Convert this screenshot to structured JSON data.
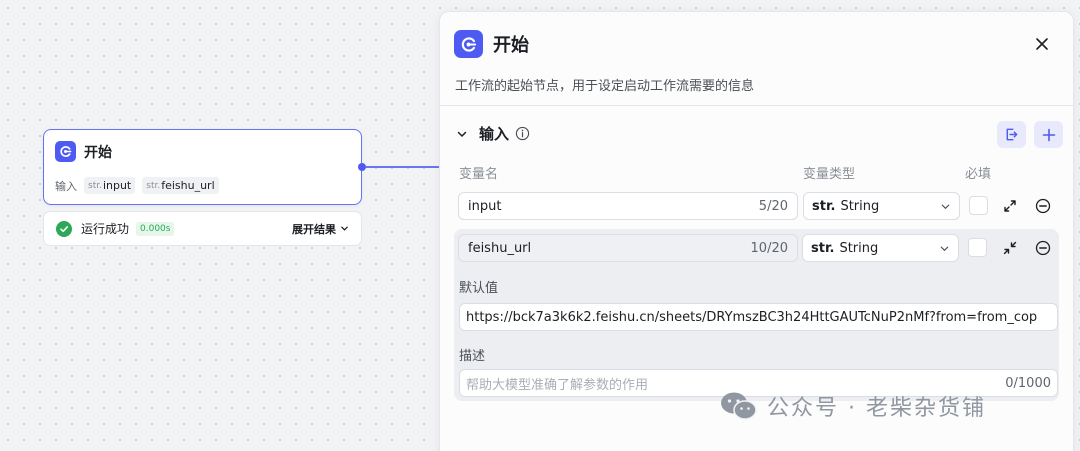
{
  "node": {
    "title": "开始",
    "inputs_label": "输入",
    "inputs": [
      {
        "prefix": "str.",
        "name": "input"
      },
      {
        "prefix": "str.",
        "name": "feishu_url"
      }
    ]
  },
  "run_status": {
    "label": "运行成功",
    "time": "0.000s",
    "expand_label": "展开结果"
  },
  "panel": {
    "title": "开始",
    "description": "工作流的起始节点，用于设定启动工作流需要的信息",
    "section_title": "输入",
    "columns": {
      "name": "变量名",
      "type": "变量类型",
      "required": "必填"
    },
    "variables": [
      {
        "name": "input",
        "counter": "5/20",
        "type_prefix": "str.",
        "type": "String"
      },
      {
        "name": "feishu_url",
        "counter": "10/20",
        "type_prefix": "str.",
        "type": "String"
      }
    ],
    "default_label": "默认值",
    "default_value": "https://bck7a3k6k2.feishu.cn/sheets/DRYmszBC3h24HttGAUTcNuP2nMf?from=from_cop",
    "desc_label": "描述",
    "desc_placeholder": "帮助大模型准确了解参数的作用",
    "desc_counter": "0/1000"
  },
  "watermark": "公众号 · 老柴杂货铺",
  "colors": {
    "accent": "#4e5bf2",
    "success": "#2ca858"
  }
}
